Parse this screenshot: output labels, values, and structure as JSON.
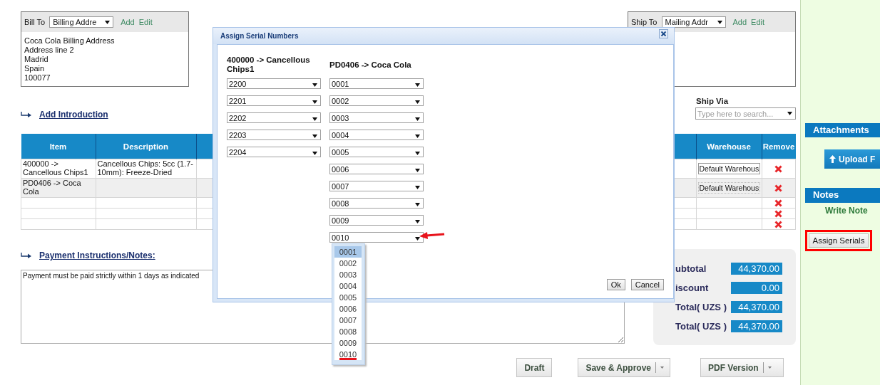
{
  "bill_to": {
    "label": "Bill To",
    "select": "Billing Addre",
    "add": "Add",
    "edit": "Edit",
    "address_lines": [
      "Coca Cola Billing Address",
      "Address line 2",
      "Madrid",
      "Spain",
      "100077"
    ]
  },
  "ship_to": {
    "label": "Ship To",
    "select": "Mailing Addr",
    "add": "Add",
    "edit": "Edit"
  },
  "add_introduction": "Add Introduction",
  "ship_via": {
    "label": "Ship Via",
    "placeholder": "Type here to search..."
  },
  "table": {
    "columns": [
      "Item",
      "Description",
      "Warehouse",
      "Remove"
    ],
    "rows": [
      {
        "kind": "item",
        "item": "400000 -> Cancellous Chips1",
        "description": "Cancellous Chips: 5cc (1.7-10mm): Freeze-Dried",
        "warehouse": "Default Warehous",
        "focused": false
      },
      {
        "kind": "item",
        "item": "PD0406 -> Coca Cola",
        "warehouse": "Default Warehous",
        "focused": true
      },
      {
        "kind": "blank"
      },
      {
        "kind": "blank"
      },
      {
        "kind": "blank"
      }
    ]
  },
  "payment": {
    "link": "Payment Instructions/Notes:",
    "text": "Payment must be paid strictly within 1 days as indicated"
  },
  "totals": [
    {
      "label": "ubtotal",
      "value": "44,370.00"
    },
    {
      "label": "iscount",
      "value": "0.00"
    },
    {
      "label": "Total( UZS )",
      "value": "44,370.00"
    },
    {
      "label": "Total( UZS )",
      "value": "44,370.00"
    }
  ],
  "actions": [
    {
      "label": "Draft",
      "kind": "plain"
    },
    {
      "label": "Save & Approve",
      "kind": "split"
    },
    {
      "label": "PDF Version",
      "kind": "split"
    }
  ],
  "sidebar": {
    "attachments": "Attachments",
    "upload": "Upload F",
    "notes": "Notes",
    "write_note": "Write Note",
    "assign_serials": {
      "label": "Assign Serials",
      "annotated": true
    }
  },
  "modal": {
    "title": "Assign Serial Numbers",
    "columns": [
      {
        "heading": "400000 -> Cancellous Chips1",
        "serials": [
          {
            "value": "2200",
            "open": false,
            "annotated": false
          },
          {
            "value": "2201",
            "open": false,
            "annotated": false
          },
          {
            "value": "2202",
            "open": false,
            "annotated": false
          },
          {
            "value": "2203",
            "open": false,
            "annotated": false
          },
          {
            "value": "2204",
            "open": false,
            "annotated": false
          }
        ]
      },
      {
        "heading": "PD0406 -> Coca Cola",
        "serials": [
          {
            "value": "0001",
            "open": false,
            "annotated": false
          },
          {
            "value": "0002",
            "open": false,
            "annotated": false
          },
          {
            "value": "0003",
            "open": false,
            "annotated": false
          },
          {
            "value": "0004",
            "open": false,
            "annotated": false
          },
          {
            "value": "0005",
            "open": false,
            "annotated": false
          },
          {
            "value": "0006",
            "open": false,
            "annotated": false
          },
          {
            "value": "0007",
            "open": false,
            "annotated": false
          },
          {
            "value": "0008",
            "open": false,
            "annotated": false
          },
          {
            "value": "0009",
            "open": false,
            "annotated": false
          },
          {
            "value": "0010",
            "open": true,
            "annotated": true
          }
        ]
      }
    ],
    "dropdown_options": [
      {
        "label": "0001",
        "selected": true,
        "annotated": false
      },
      {
        "label": "0002",
        "selected": false,
        "annotated": false
      },
      {
        "label": "0003",
        "selected": false,
        "annotated": false
      },
      {
        "label": "0004",
        "selected": false,
        "annotated": false
      },
      {
        "label": "0005",
        "selected": false,
        "annotated": false
      },
      {
        "label": "0006",
        "selected": false,
        "annotated": false
      },
      {
        "label": "0007",
        "selected": false,
        "annotated": false
      },
      {
        "label": "0008",
        "selected": false,
        "annotated": false
      },
      {
        "label": "0009",
        "selected": false,
        "annotated": false
      },
      {
        "label": "0010",
        "selected": false,
        "annotated": true
      }
    ],
    "buttons": [
      "Ok",
      "Cancel"
    ]
  }
}
